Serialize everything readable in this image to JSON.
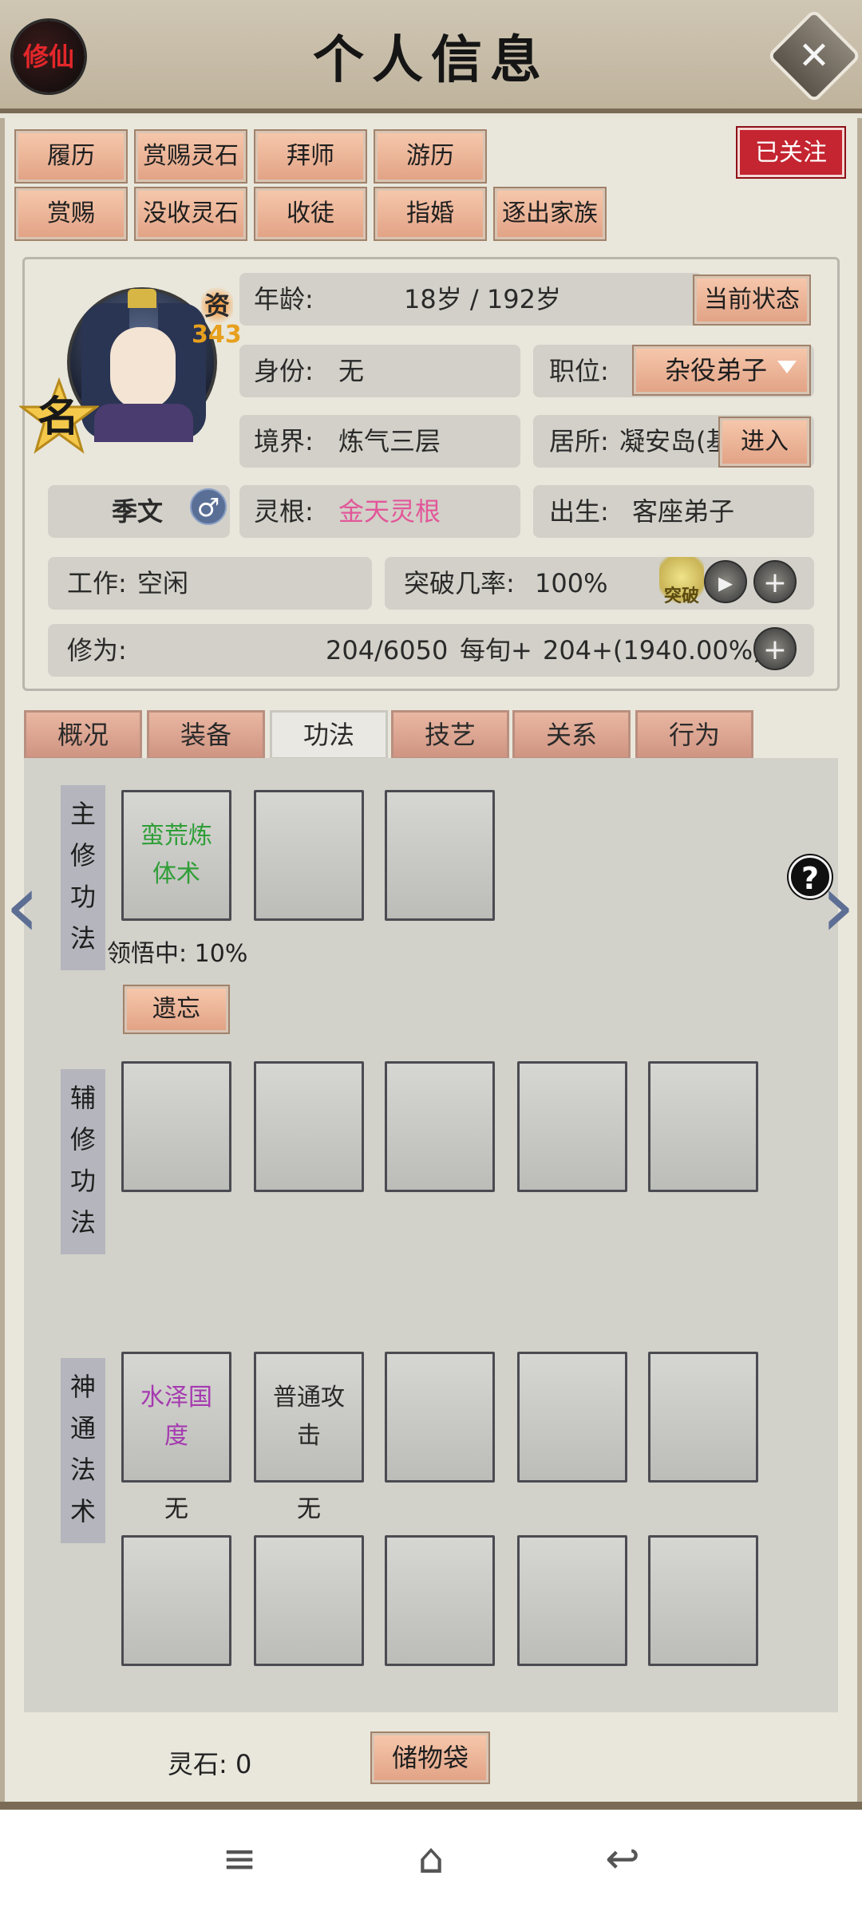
{
  "header": {
    "title": "个人信息",
    "seal_text": "修仙",
    "close_icon": "close-icon"
  },
  "actions": {
    "row1": [
      "履历",
      "赏赐灵石",
      "拜师",
      "游历"
    ],
    "row2": [
      "赏赐",
      "没收灵石",
      "收徒",
      "指婚",
      "逐出家族"
    ],
    "followed": "已关注"
  },
  "profile": {
    "name": "季文",
    "gender_symbol": "♂",
    "ming_badge": "名",
    "zi_label": "资",
    "zi_value": "343",
    "age_label": "年龄:",
    "age_value": "18岁 / 192岁",
    "status_button": "当前状态",
    "identity_label": "身份:",
    "identity_value": "无",
    "position_label": "职位:",
    "position_value": "杂役弟子",
    "realm_label": "境界:",
    "realm_value": "炼气三层",
    "residence_label": "居所:",
    "residence_value": "凝安岛(基",
    "enter_button": "进入",
    "root_label": "灵根:",
    "root_value": "金天灵根",
    "root_color": "#e2579a",
    "birth_label": "出生:",
    "birth_value": "客座弟子",
    "work_label": "工作:",
    "work_value": "空闲",
    "breakthrough_label": "突破几率:",
    "breakthrough_value": "100%",
    "breakthrough_icon_text": "突破",
    "cultivation_label": "修为:",
    "cultivation_value": "204/6050",
    "per_turn_label": "每旬+",
    "per_turn_value": "204+(1940.00%)"
  },
  "tabs": [
    "概况",
    "装备",
    "功法",
    "技艺",
    "关系",
    "行为"
  ],
  "active_tab": "功法",
  "skills": {
    "main_label": [
      "主",
      "修",
      "功",
      "法"
    ],
    "main_slots": [
      "蛮荒炼体术",
      "",
      ""
    ],
    "comprehension": "领悟中: 10%",
    "forget_button": "遗忘",
    "aux_label": [
      "辅",
      "修",
      "功",
      "法"
    ],
    "aux_slots": [
      "",
      "",
      "",
      "",
      ""
    ],
    "divine_label": [
      "神",
      "通",
      "法",
      "术"
    ],
    "divine_slots_row1": [
      "水泽国度",
      "普通攻击",
      "",
      "",
      ""
    ],
    "divine_under": [
      "无",
      "无"
    ],
    "divine_slots_row2": [
      "",
      "",
      "",
      "",
      ""
    ]
  },
  "footer": {
    "spirit_stone": "灵石: 0",
    "bag_button": "储物袋"
  },
  "nav": [
    "menu-icon",
    "home-icon",
    "back-icon"
  ]
}
